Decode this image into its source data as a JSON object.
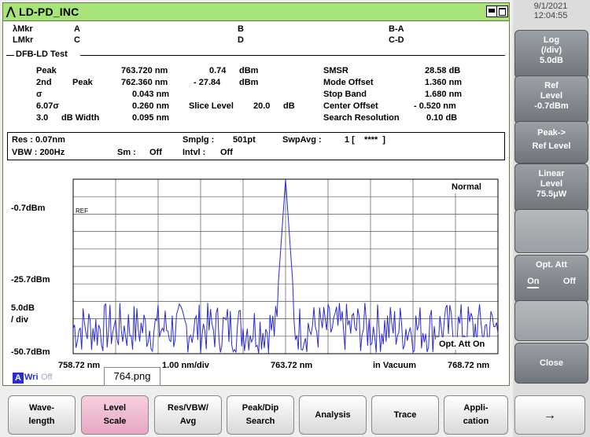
{
  "window": {
    "title": "LD-PD_INC",
    "title_icon": "antenna-icon"
  },
  "datetime": {
    "date": "9/1/2021",
    "time": "12:04:55"
  },
  "markers": {
    "lambda_mkr": "λMkr",
    "l_mkr": "LMkr",
    "a": "A",
    "b": "B",
    "c": "C",
    "d": "D",
    "ba": "B-A",
    "cd": "C-D"
  },
  "test_section": "DFB-LD Test",
  "results_left": {
    "peak_label": "Peak",
    "peak_wl": "763.720 nm",
    "peak_lvl": "0.74",
    "peak_unit": "dBm",
    "second_label": "2nd",
    "second_label2": "Peak",
    "second_wl": "762.360 nm",
    "second_lvl": "- 27.84",
    "second_unit": "dBm",
    "sigma_label": "σ",
    "sigma_val": "0.043 nm",
    "six_sigma_label": "6.07σ",
    "six_sigma_val": "0.260 nm",
    "slice_label": "Slice Level",
    "slice_val": "20.0",
    "slice_unit": "dB",
    "width_num": "3.0",
    "width_label": "dB Width",
    "width_val": "0.095 nm"
  },
  "results_right": {
    "smsr_label": "SMSR",
    "smsr_val": "28.58 dB",
    "mode_label": "Mode Offset",
    "mode_val": "1.360 nm",
    "stop_label": "Stop Band",
    "stop_val": "1.680 nm",
    "center_label": "Center Offset",
    "center_val": "- 0.520 nm",
    "res_label": "Search Resolution",
    "res_val": "0.10  dB"
  },
  "settings": {
    "res": "Res : 0.07nm",
    "vbw": "VBW :  200Hz",
    "smplg_label": "Smplg :",
    "smplg_val": "501pt",
    "swpavg_label": "SwpAvg :",
    "swpavg_val": "1 [    ****  ]",
    "sm_label": "Sm :",
    "sm_val": "Off",
    "intvl_label": "Intvl :",
    "intvl_val": "Off"
  },
  "chart_labels": {
    "mode": "Normal",
    "ref": "REF",
    "y_top": "-0.7dBm",
    "y_mid": "-25.7dBm",
    "y_scale1": "5.0dB",
    "y_scale2": "/ div",
    "y_bot": "-50.7dBm",
    "x_left": "758.72 nm",
    "x_div": "1.00 nm/div",
    "x_center": "763.72 nm",
    "x_medium": "in Vacuum",
    "x_right": "768.72 nm",
    "opt_att": "Opt. Att On",
    "trace_a": "A",
    "trace_wri": "Wri",
    "trace_off": "Off"
  },
  "tooltip": "764.png",
  "softkeys": [
    {
      "l1": "Log",
      "l2": "(/div)",
      "l3": "5.0dB"
    },
    {
      "l1": "Ref",
      "l2": "Level",
      "l3": "-0.7dBm"
    },
    {
      "l1": "Peak->",
      "l2": "Ref Level"
    },
    {
      "l1": "Linear",
      "l2": "Level",
      "l3": "75.5μW"
    },
    {
      "l1": "Opt. Att",
      "on": "On",
      "off": "Off"
    },
    {
      "l1": "Close"
    }
  ],
  "bottom_keys": [
    {
      "l1": "Wave-",
      "l2": "length"
    },
    {
      "l1": "Level",
      "l2": "Scale"
    },
    {
      "l1": "Res/VBW/",
      "l2": "Avg"
    },
    {
      "l1": "Peak/Dip",
      "l2": "Search"
    },
    {
      "l1": "Analysis"
    },
    {
      "l1": "Trace"
    },
    {
      "l1": "Appli-",
      "l2": "cation"
    },
    {
      "l1": "→"
    }
  ],
  "colors": {
    "trace": "#2b2bd6",
    "titlebar": "#a8e37a",
    "active_key": "#f0bcd2"
  },
  "chart_data": {
    "type": "line",
    "x_unit": "nm",
    "y_unit": "dBm",
    "xlim": [
      758.72,
      768.72
    ],
    "ylim": [
      -50.7,
      -0.7
    ],
    "peak": {
      "x": 763.72,
      "y": -0.74
    },
    "noise_floor": [
      -50.7,
      -36.0
    ],
    "series": [
      {
        "name": "A"
      }
    ]
  }
}
